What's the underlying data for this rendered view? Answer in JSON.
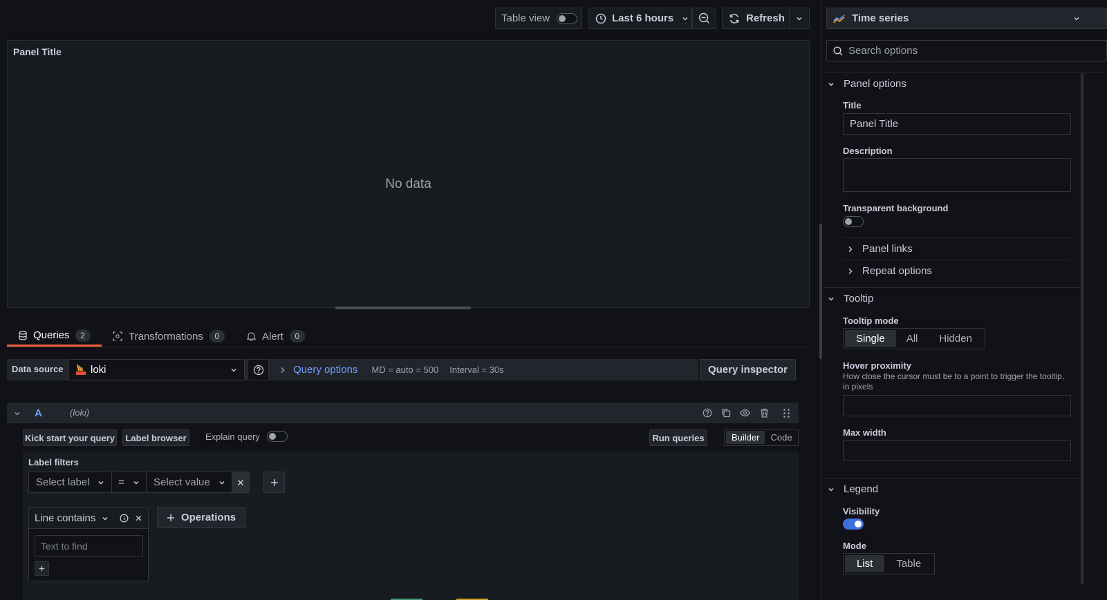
{
  "toolbar": {
    "table_view_label": "Table view",
    "time_range_label": "Last 6 hours",
    "refresh_label": "Refresh"
  },
  "panel": {
    "title": "Panel Title",
    "empty_message": "No data"
  },
  "tabs": [
    {
      "label": "Queries",
      "count": "2"
    },
    {
      "label": "Transformations",
      "count": "0"
    },
    {
      "label": "Alert",
      "count": "0"
    }
  ],
  "datasource": {
    "label": "Data source",
    "value": "loki",
    "query_options_label": "Query options",
    "md_text": "MD = auto = 500",
    "interval_text": "Interval = 30s",
    "query_inspector_label": "Query inspector"
  },
  "query": {
    "ref_id": "A",
    "datasource_name": "(loki)",
    "kick_start_label": "Kick start your query",
    "label_browser_label": "Label browser",
    "explain_query_label": "Explain query",
    "run_queries_label": "Run queries",
    "builder_label": "Builder",
    "code_label": "Code",
    "label_filters_title": "Label filters",
    "select_label_placeholder": "Select label",
    "operator_value": "=",
    "select_value_placeholder": "Select value",
    "line_contains_label": "Line contains",
    "text_to_find_placeholder": "Text to find",
    "operations_label": "Operations"
  },
  "options": {
    "visualization": "Time series",
    "search_placeholder": "Search options",
    "panel_options_title": "Panel options",
    "title_label": "Title",
    "title_value": "Panel Title",
    "description_label": "Description",
    "transparent_background_label": "Transparent background",
    "panel_links_label": "Panel links",
    "repeat_options_label": "Repeat options",
    "tooltip_title": "Tooltip",
    "tooltip_mode_label": "Tooltip mode",
    "tooltip_modes": [
      "Single",
      "All",
      "Hidden"
    ],
    "tooltip_mode_selected": "Single",
    "hover_proximity_label": "Hover proximity",
    "hover_proximity_desc": "How close the cursor must be to a point to trigger the tooltip, in pixels",
    "max_width_label": "Max width",
    "legend_title": "Legend",
    "visibility_label": "Visibility",
    "visibility_on": true,
    "mode_label": "Mode",
    "legend_modes": [
      "List",
      "Table"
    ],
    "legend_mode_selected": "List"
  },
  "colors": {
    "background": "#111217",
    "panel": "#181b1f",
    "accent_blue": "#6e9fff",
    "active_tab_underline": "#f55f3e",
    "toggle_on": "#3d71d9"
  }
}
